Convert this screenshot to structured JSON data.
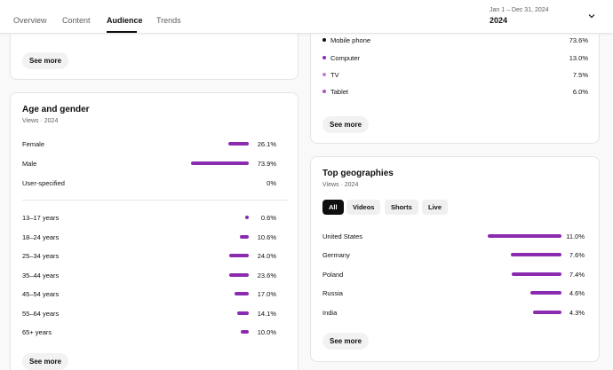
{
  "tabs": [
    {
      "label": "Overview"
    },
    {
      "label": "Content"
    },
    {
      "label": "Audience"
    },
    {
      "label": "Trends"
    }
  ],
  "date_range": "Jan 1 – Dec 31, 2024",
  "period_label": "2024",
  "icons": {
    "chevron": "chevron-down-icon"
  },
  "see_more": "See more",
  "age_gender": {
    "title": "Age and gender",
    "subtitle": "Views · 2024",
    "gender": [
      {
        "label": "Female",
        "value": "26.1%",
        "pct": 26.1
      },
      {
        "label": "Male",
        "value": "73.9%",
        "pct": 73.9
      },
      {
        "label": "User-specified",
        "value": "0%",
        "pct": 0
      }
    ],
    "age": [
      {
        "label": "13–17 years",
        "value": "0.6%",
        "pct": 0.6
      },
      {
        "label": "18–24 years",
        "value": "10.6%",
        "pct": 10.6
      },
      {
        "label": "25–34 years",
        "value": "24.0%",
        "pct": 24.0
      },
      {
        "label": "35–44 years",
        "value": "23.6%",
        "pct": 23.6
      },
      {
        "label": "45–54 years",
        "value": "17.0%",
        "pct": 17.0
      },
      {
        "label": "55–64 years",
        "value": "14.1%",
        "pct": 14.1
      },
      {
        "label": "65+ years",
        "value": "10.0%",
        "pct": 10.0
      }
    ]
  },
  "devices": [
    {
      "label": "Mobile phone",
      "value": "73.6%",
      "color": "#0f0f0f"
    },
    {
      "label": "Computer",
      "value": "13.0%",
      "color": "#8a2bb0"
    },
    {
      "label": "TV",
      "value": "7.5%",
      "color": "#c77dde"
    },
    {
      "label": "Tablet",
      "value": "6.0%",
      "color": "#b04fc8"
    }
  ],
  "geographies": {
    "title": "Top geographies",
    "subtitle": "Views · 2024",
    "filters": [
      {
        "label": "All",
        "active": true
      },
      {
        "label": "Videos",
        "active": false
      },
      {
        "label": "Shorts",
        "active": false
      },
      {
        "label": "Live",
        "active": false
      }
    ],
    "rows": [
      {
        "label": "United States",
        "value": "11.0%",
        "pct": 11.0
      },
      {
        "label": "Germany",
        "value": "7.6%",
        "pct": 7.6
      },
      {
        "label": "Poland",
        "value": "7.4%",
        "pct": 7.4
      },
      {
        "label": "Russia",
        "value": "4.6%",
        "pct": 4.6
      },
      {
        "label": "India",
        "value": "4.3%",
        "pct": 4.3
      }
    ]
  },
  "colors": {
    "accent": "#8a2bb0"
  }
}
